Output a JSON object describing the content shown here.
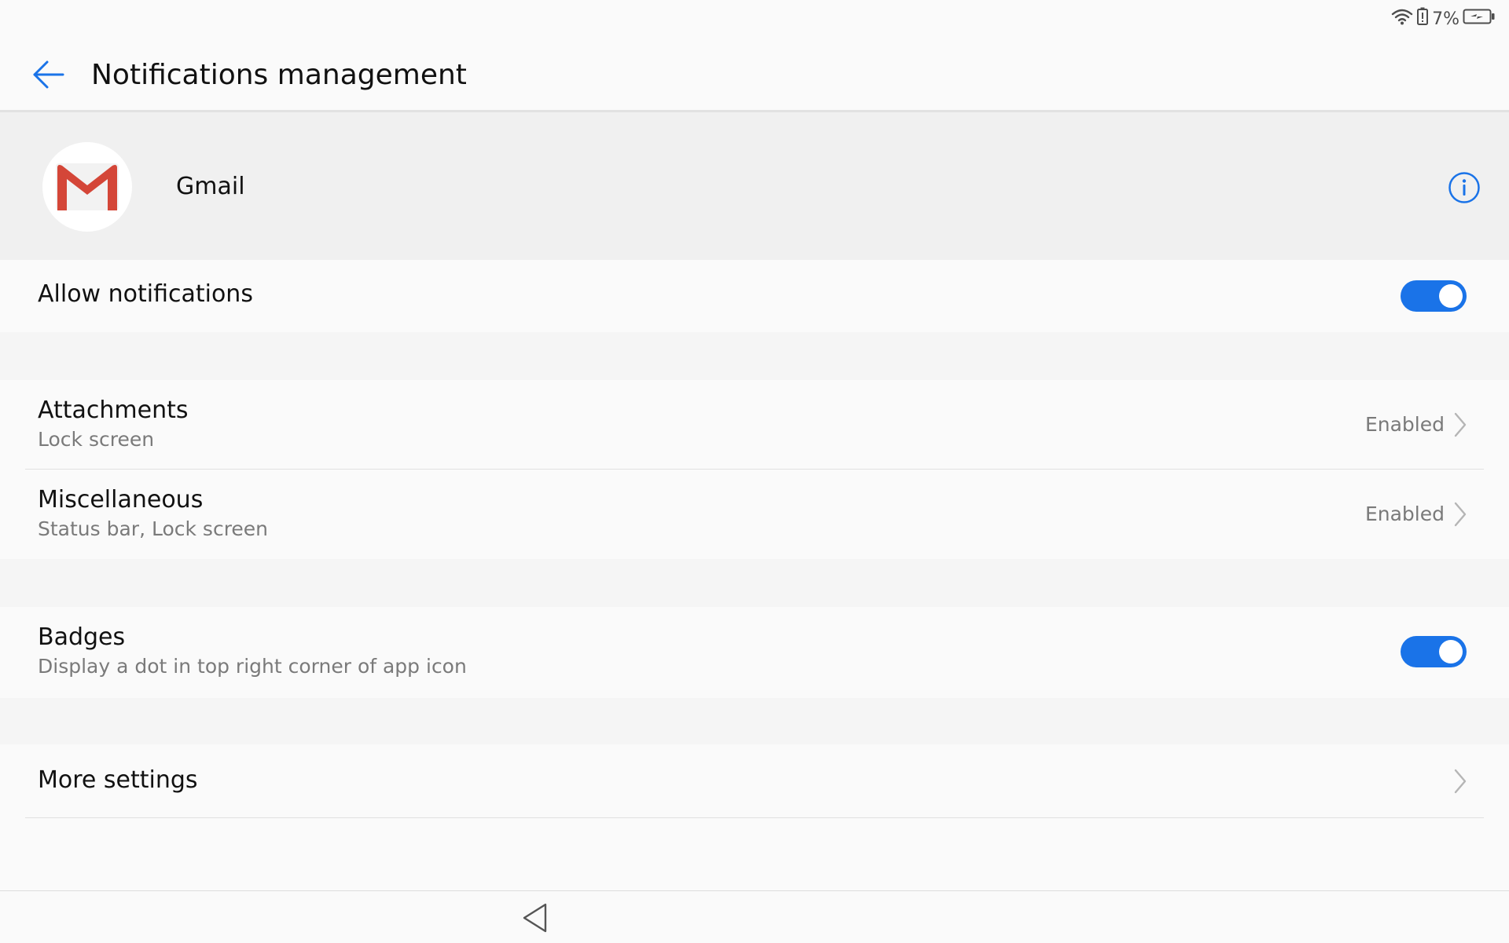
{
  "status_bar": {
    "battery_percent": "7%",
    "icons": [
      "wifi-icon",
      "battery-alert-icon",
      "battery-charging-icon"
    ]
  },
  "header": {
    "title": "Notifications management",
    "back_icon": "arrow-left-icon"
  },
  "app": {
    "name": "Gmail",
    "icon": "gmail-icon",
    "info_icon": "info-icon"
  },
  "settings": {
    "allow_notifications": {
      "label": "Allow notifications",
      "enabled": true
    },
    "channels": [
      {
        "title": "Attachments",
        "subtitle": "Lock screen",
        "value": "Enabled"
      },
      {
        "title": "Miscellaneous",
        "subtitle": "Status bar, Lock screen",
        "value": "Enabled"
      }
    ],
    "badges": {
      "title": "Badges",
      "subtitle": "Display a dot in top right corner of app icon",
      "enabled": true
    },
    "more": {
      "title": "More settings"
    }
  },
  "colors": {
    "accent": "#1a73e8",
    "gmail_red": "#d44638"
  }
}
